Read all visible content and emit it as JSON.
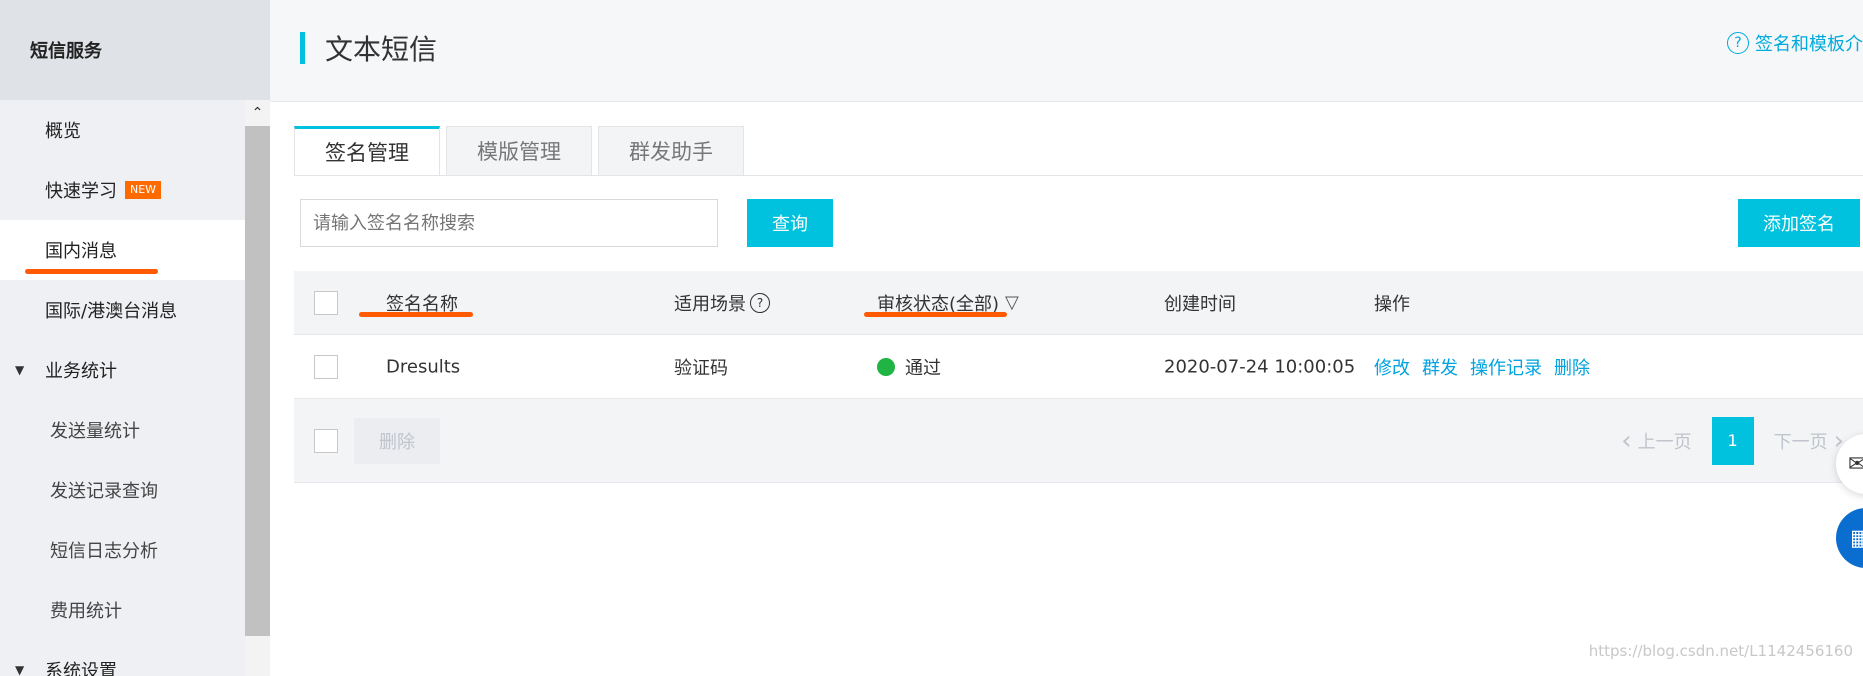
{
  "sidebar": {
    "header": "短信服务",
    "items": [
      {
        "label": "概览"
      },
      {
        "label": "快速学习",
        "badge": "NEW"
      },
      {
        "label": "国内消息"
      },
      {
        "label": "国际/港澳台消息"
      },
      {
        "label": "业务统计"
      },
      {
        "label": "发送量统计"
      },
      {
        "label": "发送记录查询"
      },
      {
        "label": "短信日志分析"
      },
      {
        "label": "费用统计"
      },
      {
        "label": "系统设置"
      }
    ]
  },
  "header": {
    "title": "文本短信",
    "help_link": "签名和模板介"
  },
  "tabs": [
    {
      "label": "签名管理",
      "active": true
    },
    {
      "label": "模版管理",
      "active": false
    },
    {
      "label": "群发助手",
      "active": false
    }
  ],
  "toolbar": {
    "search_placeholder": "请输入签名名称搜索",
    "query_label": "查询",
    "add_label": "添加签名"
  },
  "table": {
    "columns": [
      "签名名称",
      "适用场景",
      "审核状态(全部)",
      "创建时间",
      "操作"
    ],
    "rows": [
      {
        "name": "Dresults",
        "scene": "验证码",
        "status": "通过",
        "status_color": "#1fb443",
        "created": "2020-07-24 10:00:05",
        "actions": [
          "修改",
          "群发",
          "操作记录",
          "删除"
        ]
      }
    ]
  },
  "footer": {
    "delete_label": "删除",
    "prev_label": "上一页",
    "page": "1",
    "next_label": "下一页"
  },
  "watermark": "https://blog.csdn.net/L1142456160",
  "colors": {
    "accent": "#00c1de",
    "link": "#00a2e0",
    "highlight": "#ff5a00",
    "new_badge": "#ff6a00"
  }
}
